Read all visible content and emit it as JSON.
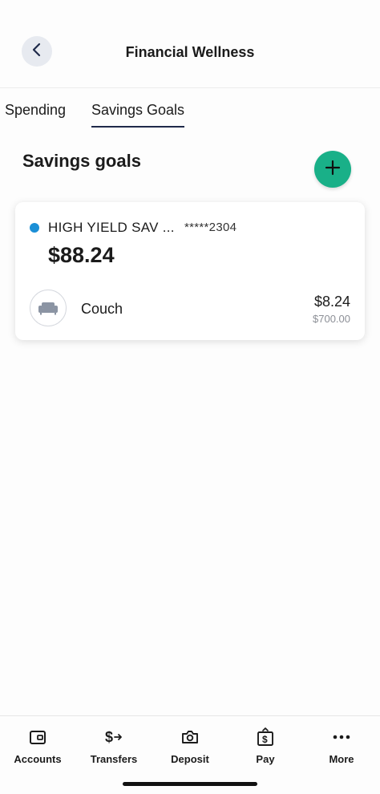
{
  "header": {
    "title": "Financial Wellness",
    "back_icon": "chevron-left-icon"
  },
  "tabs": [
    {
      "label": "Spending",
      "active": false
    },
    {
      "label": "Savings Goals",
      "active": true
    }
  ],
  "section": {
    "title": "Savings goals",
    "add_icon": "plus-icon",
    "add_color": "#19b088"
  },
  "account": {
    "name": "HIGH YIELD SAV ...",
    "number": "*****2304",
    "balance": "$88.24",
    "dot_color": "#1b8fd6"
  },
  "goals": [
    {
      "name": "Couch",
      "icon": "couch-icon",
      "saved": "$8.24",
      "target": "$700.00"
    }
  ],
  "bottom_nav": [
    {
      "label": "Accounts",
      "icon": "wallet-icon"
    },
    {
      "label": "Transfers",
      "icon": "dollar-transfer-icon"
    },
    {
      "label": "Deposit",
      "icon": "camera-icon"
    },
    {
      "label": "Pay",
      "icon": "bill-pay-icon"
    },
    {
      "label": "More",
      "icon": "more-dots-icon"
    }
  ]
}
